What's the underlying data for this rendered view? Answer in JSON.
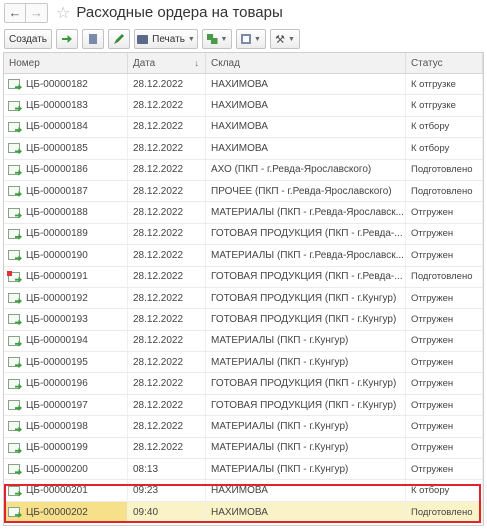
{
  "window": {
    "title": "Расходные ордера на товары",
    "back_icon": "←",
    "forward_icon": "→",
    "favorite_icon": "☆"
  },
  "toolbar": {
    "create_label": "Создать",
    "print_label": "Печать",
    "tools_icon": "⚒"
  },
  "table": {
    "columns": {
      "number": "Номер",
      "date": "Дата",
      "sort_icon": "↓",
      "warehouse": "Склад",
      "status": "Статус"
    },
    "rows": [
      {
        "number": "ЦБ-00000182",
        "date": "28.12.2022",
        "warehouse": "НАХИМОВА",
        "status": "К отгрузке",
        "icon": "doc-green-arrow-icon"
      },
      {
        "number": "ЦБ-00000183",
        "date": "28.12.2022",
        "warehouse": "НАХИМОВА",
        "status": "К отгрузке",
        "icon": "doc-green-arrow-icon"
      },
      {
        "number": "ЦБ-00000184",
        "date": "28.12.2022",
        "warehouse": "НАХИМОВА",
        "status": "К отбору",
        "icon": "doc-green-arrow-icon"
      },
      {
        "number": "ЦБ-00000185",
        "date": "28.12.2022",
        "warehouse": "НАХИМОВА",
        "status": "К отбору",
        "icon": "doc-green-arrow-icon"
      },
      {
        "number": "ЦБ-00000186",
        "date": "28.12.2022",
        "warehouse": "АХО (ПКП - г.Ревда-Ярославского)",
        "status": "Подготовлено",
        "icon": "doc-green-arrow-icon"
      },
      {
        "number": "ЦБ-00000187",
        "date": "28.12.2022",
        "warehouse": "ПРОЧЕЕ (ПКП - г.Ревда-Ярославского)",
        "status": "Подготовлено",
        "icon": "doc-green-arrow-icon"
      },
      {
        "number": "ЦБ-00000188",
        "date": "28.12.2022",
        "warehouse": "МАТЕРИАЛЫ (ПКП - г.Ревда-Ярославск...",
        "status": "Отгружен",
        "icon": "doc-green-arrow-icon"
      },
      {
        "number": "ЦБ-00000189",
        "date": "28.12.2022",
        "warehouse": "ГОТОВАЯ ПРОДУКЦИЯ (ПКП - г.Ревда-...",
        "status": "Отгружен",
        "icon": "doc-green-arrow-icon"
      },
      {
        "number": "ЦБ-00000190",
        "date": "28.12.2022",
        "warehouse": "МАТЕРИАЛЫ (ПКП - г.Ревда-Ярославск...",
        "status": "Отгружен",
        "icon": "doc-green-arrow-icon"
      },
      {
        "number": "ЦБ-00000191",
        "date": "28.12.2022",
        "warehouse": "ГОТОВАЯ ПРОДУКЦИЯ (ПКП - г.Ревда-...",
        "status": "Подготовлено",
        "icon": "doc-marked-icon"
      },
      {
        "number": "ЦБ-00000192",
        "date": "28.12.2022",
        "warehouse": "ГОТОВАЯ ПРОДУКЦИЯ (ПКП - г.Кунгур)",
        "status": "Отгружен",
        "icon": "doc-green-arrow-icon"
      },
      {
        "number": "ЦБ-00000193",
        "date": "28.12.2022",
        "warehouse": "ГОТОВАЯ ПРОДУКЦИЯ (ПКП - г.Кунгур)",
        "status": "Отгружен",
        "icon": "doc-green-arrow-icon"
      },
      {
        "number": "ЦБ-00000194",
        "date": "28.12.2022",
        "warehouse": "МАТЕРИАЛЫ (ПКП - г.Кунгур)",
        "status": "Отгружен",
        "icon": "doc-green-arrow-icon"
      },
      {
        "number": "ЦБ-00000195",
        "date": "28.12.2022",
        "warehouse": "МАТЕРИАЛЫ (ПКП - г.Кунгур)",
        "status": "Отгружен",
        "icon": "doc-green-arrow-icon"
      },
      {
        "number": "ЦБ-00000196",
        "date": "28.12.2022",
        "warehouse": "ГОТОВАЯ ПРОДУКЦИЯ (ПКП - г.Кунгур)",
        "status": "Отгружен",
        "icon": "doc-green-arrow-icon"
      },
      {
        "number": "ЦБ-00000197",
        "date": "28.12.2022",
        "warehouse": "ГОТОВАЯ ПРОДУКЦИЯ (ПКП - г.Кунгур)",
        "status": "Отгружен",
        "icon": "doc-green-arrow-icon"
      },
      {
        "number": "ЦБ-00000198",
        "date": "28.12.2022",
        "warehouse": "МАТЕРИАЛЫ (ПКП - г.Кунгур)",
        "status": "Отгружен",
        "icon": "doc-green-arrow-icon"
      },
      {
        "number": "ЦБ-00000199",
        "date": "28.12.2022",
        "warehouse": "МАТЕРИАЛЫ (ПКП - г.Кунгур)",
        "status": "Отгружен",
        "icon": "doc-green-arrow-icon"
      },
      {
        "number": "ЦБ-00000200",
        "date": "08:13",
        "warehouse": "МАТЕРИАЛЫ (ПКП - г.Кунгур)",
        "status": "Отгружен",
        "icon": "doc-green-arrow-icon"
      },
      {
        "number": "ЦБ-00000201",
        "date": "09:23",
        "warehouse": "НАХИМОВА",
        "status": "К отбору",
        "icon": "doc-green-arrow-icon"
      },
      {
        "number": "ЦБ-00000202",
        "date": "09:40",
        "warehouse": "НАХИМОВА",
        "status": "Подготовлено",
        "icon": "doc-green-arrow-icon",
        "selected": true
      }
    ]
  },
  "colors": {
    "highlight_box": "#e0242e",
    "selected_row": "#fbf3c8",
    "selected_cell": "#f6e08a"
  }
}
